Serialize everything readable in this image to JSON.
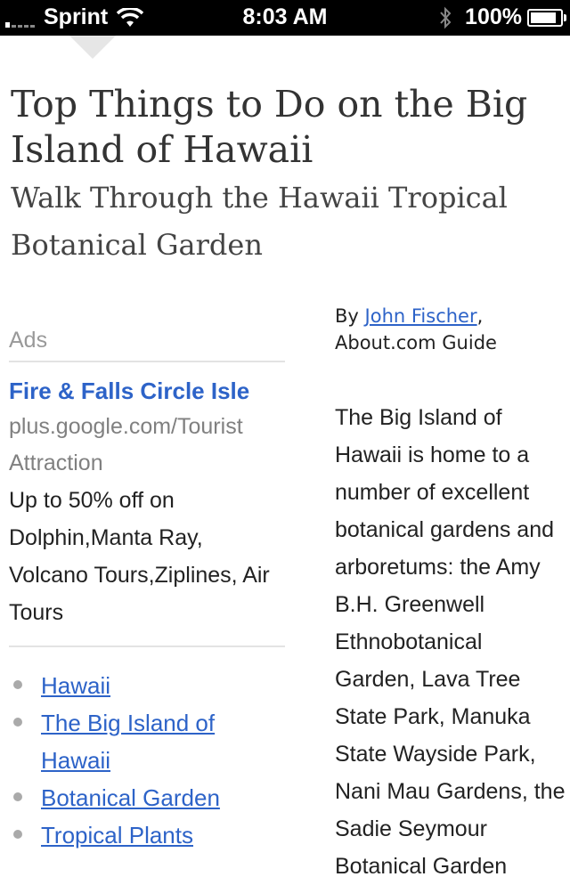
{
  "status_bar": {
    "carrier": "Sprint",
    "time": "8:03 AM",
    "battery_percent": "100%",
    "battery_level": 1.0,
    "signal_bars": 1
  },
  "article": {
    "title": "Top Things to Do on the Big Island of Hawaii",
    "subtitle": "Walk Through the Hawaii Tropical Botanical Garden",
    "byline_prefix": "By",
    "author": "John Fischer",
    "byline_suffix": ",",
    "role": "About.com Guide",
    "body": "The Big Island of Hawaii is home to a number of excellent botanical gardens and arboretums: the Amy B.H. Greenwell Ethnobotanical Garden, Lava Tree State Park, Manuka State Wayside Park, Nani Mau Gardens, the Sadie Seymour Botanical Garden"
  },
  "ads": {
    "label": "Ads",
    "title": "Fire & Falls Circle Isle",
    "url": "plus.google.com/Tourist Attraction",
    "description": "Up to 50% off on Dolphin,Manta Ray, Volcano Tours,Ziplines, Air Tours"
  },
  "related_links": [
    {
      "label": "Hawaii"
    },
    {
      "label": "The Big Island of Hawaii"
    },
    {
      "label": "Botanical Garden"
    },
    {
      "label": "Tropical Plants"
    }
  ],
  "colors": {
    "link": "#2d63c8",
    "status_bar": "#000000",
    "title": "#333333"
  }
}
